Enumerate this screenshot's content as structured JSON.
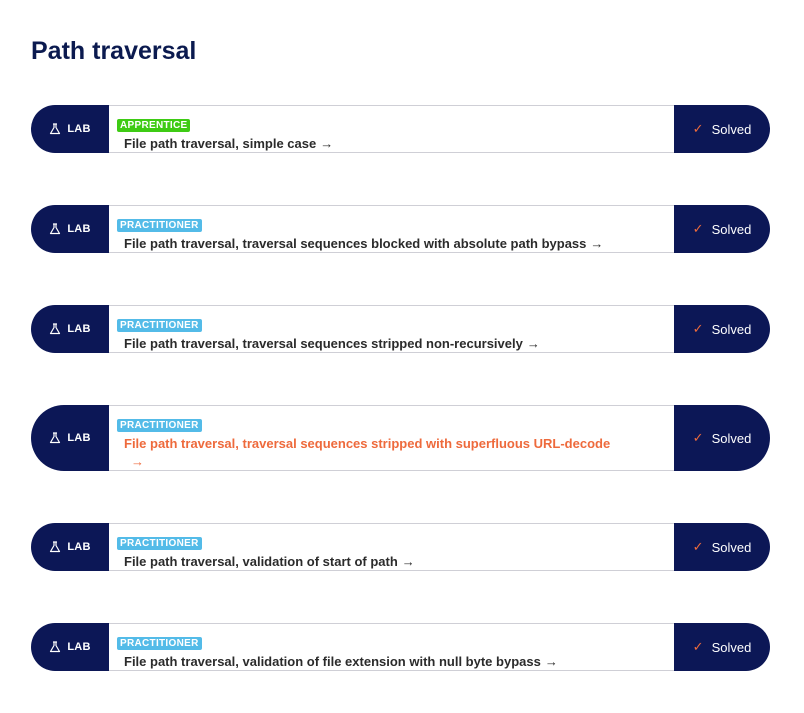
{
  "page": {
    "title": "Path traversal"
  },
  "colors": {
    "navy": "#0c1756",
    "apprentice": "#3ecb14",
    "practitioner": "#53bbe8",
    "accent": "#ee6a3c"
  },
  "labs": [
    {
      "lab_label": "LAB",
      "level": "APPRENTICE",
      "level_color": "#3ecb14",
      "title": "File path traversal, simple case",
      "arrow": "→",
      "status": "Solved",
      "hover": false
    },
    {
      "lab_label": "LAB",
      "level": "PRACTITIONER",
      "level_color": "#53bbe8",
      "title": "File path traversal, traversal sequences blocked with absolute path bypass",
      "arrow": "→",
      "status": "Solved",
      "hover": false
    },
    {
      "lab_label": "LAB",
      "level": "PRACTITIONER",
      "level_color": "#53bbe8",
      "title": "File path traversal, traversal sequences stripped non-recursively",
      "arrow": "→",
      "status": "Solved",
      "hover": false
    },
    {
      "lab_label": "LAB",
      "level": "PRACTITIONER",
      "level_color": "#53bbe8",
      "title": "File path traversal, traversal sequences stripped with superfluous URL-decode",
      "arrow": "→",
      "status": "Solved",
      "hover": true
    },
    {
      "lab_label": "LAB",
      "level": "PRACTITIONER",
      "level_color": "#53bbe8",
      "title": "File path traversal, validation of start of path",
      "arrow": "→",
      "status": "Solved",
      "hover": false
    },
    {
      "lab_label": "LAB",
      "level": "PRACTITIONER",
      "level_color": "#53bbe8",
      "title": "File path traversal, validation of file extension with null byte bypass",
      "arrow": "→",
      "status": "Solved",
      "hover": false
    }
  ]
}
